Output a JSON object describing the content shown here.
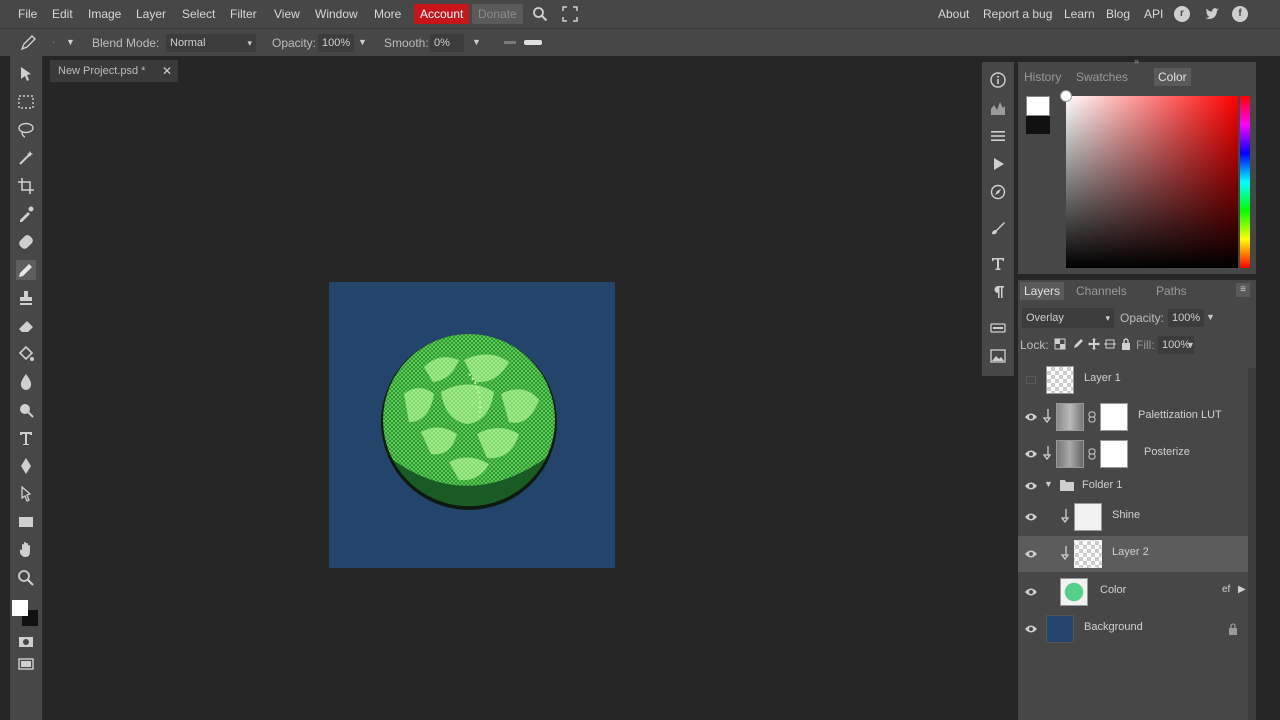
{
  "menubar": {
    "items": [
      "File",
      "Edit",
      "Image",
      "Layer",
      "Select",
      "Filter",
      "View",
      "Window",
      "More"
    ],
    "account": "Account",
    "donate": "Donate",
    "right_links": [
      "About",
      "Report a bug",
      "Learn",
      "Blog",
      "API"
    ],
    "social_icons": [
      "reddit-icon",
      "twitter-icon",
      "facebook-icon"
    ]
  },
  "options": {
    "blend_mode_label": "Blend Mode:",
    "blend_mode_value": "Normal",
    "opacity_label": "Opacity:",
    "opacity_value": "100%",
    "smooth_label": "Smooth:",
    "smooth_value": "0%"
  },
  "document": {
    "tab_title": "New Project.psd *",
    "canvas_color": "#24456b"
  },
  "color_panel": {
    "tabs": [
      "History",
      "Swatches",
      "Color"
    ],
    "active_tab": "Color",
    "foreground": "#ffffff",
    "background": "#111111",
    "hue": "#ff0000"
  },
  "layers_panel": {
    "tabs": [
      "Layers",
      "Channels",
      "Paths"
    ],
    "active_tab": "Layers",
    "blend_mode": "Overlay",
    "opacity_label": "Opacity:",
    "opacity_value": "100%",
    "lock_label": "Lock:",
    "fill_label": "Fill:",
    "fill_value": "100%",
    "layers": [
      {
        "name": "Layer 1",
        "visible": false,
        "thumb": "checker"
      },
      {
        "name": "Palettization LUT",
        "visible": true,
        "thumb": "adjustment"
      },
      {
        "name": "Posterize",
        "visible": true,
        "thumb": "adjustment"
      },
      {
        "name": "Folder 1",
        "visible": true,
        "thumb": "folder"
      },
      {
        "name": "Shine",
        "visible": true,
        "thumb": "white"
      },
      {
        "name": "Layer 2",
        "visible": true,
        "thumb": "checker",
        "selected": true
      },
      {
        "name": "Color",
        "visible": true,
        "thumb": "green"
      },
      {
        "name": "Background",
        "visible": true,
        "thumb": "blue",
        "locked": true
      }
    ],
    "effects_label": "ef"
  }
}
